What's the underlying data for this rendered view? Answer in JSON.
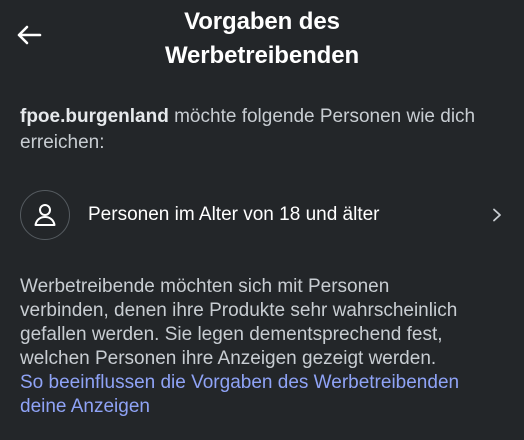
{
  "header": {
    "title_line1": "Vorgaben des",
    "title_line2": "Werbetreibenden",
    "back_icon": "arrow-left-icon"
  },
  "intro": {
    "advertiser": "fpoe.burgenland",
    "text": " möchte folgende Personen wie dich erreichen:"
  },
  "audience": {
    "label": "Personen im Alter von 18 und älter",
    "icon": "person-icon",
    "chevron_icon": "chevron-right-icon"
  },
  "description": {
    "lines": [
      "Werbetreibende möchten sich mit Personen",
      "verbinden, denen ihre Produkte sehr wahrscheinlich",
      "gefallen werden. Sie legen dementsprechend fest,",
      "welchen Personen ihre Anzeigen gezeigt werden."
    ],
    "link_lines": [
      "So beeinflussen die Vorgaben des Werbetreibenden",
      "deine Anzeigen"
    ]
  },
  "colors": {
    "background": "#232629",
    "text": "#ffffff",
    "secondary_text": "#c8cdd2",
    "link": "#8fa3f6"
  }
}
